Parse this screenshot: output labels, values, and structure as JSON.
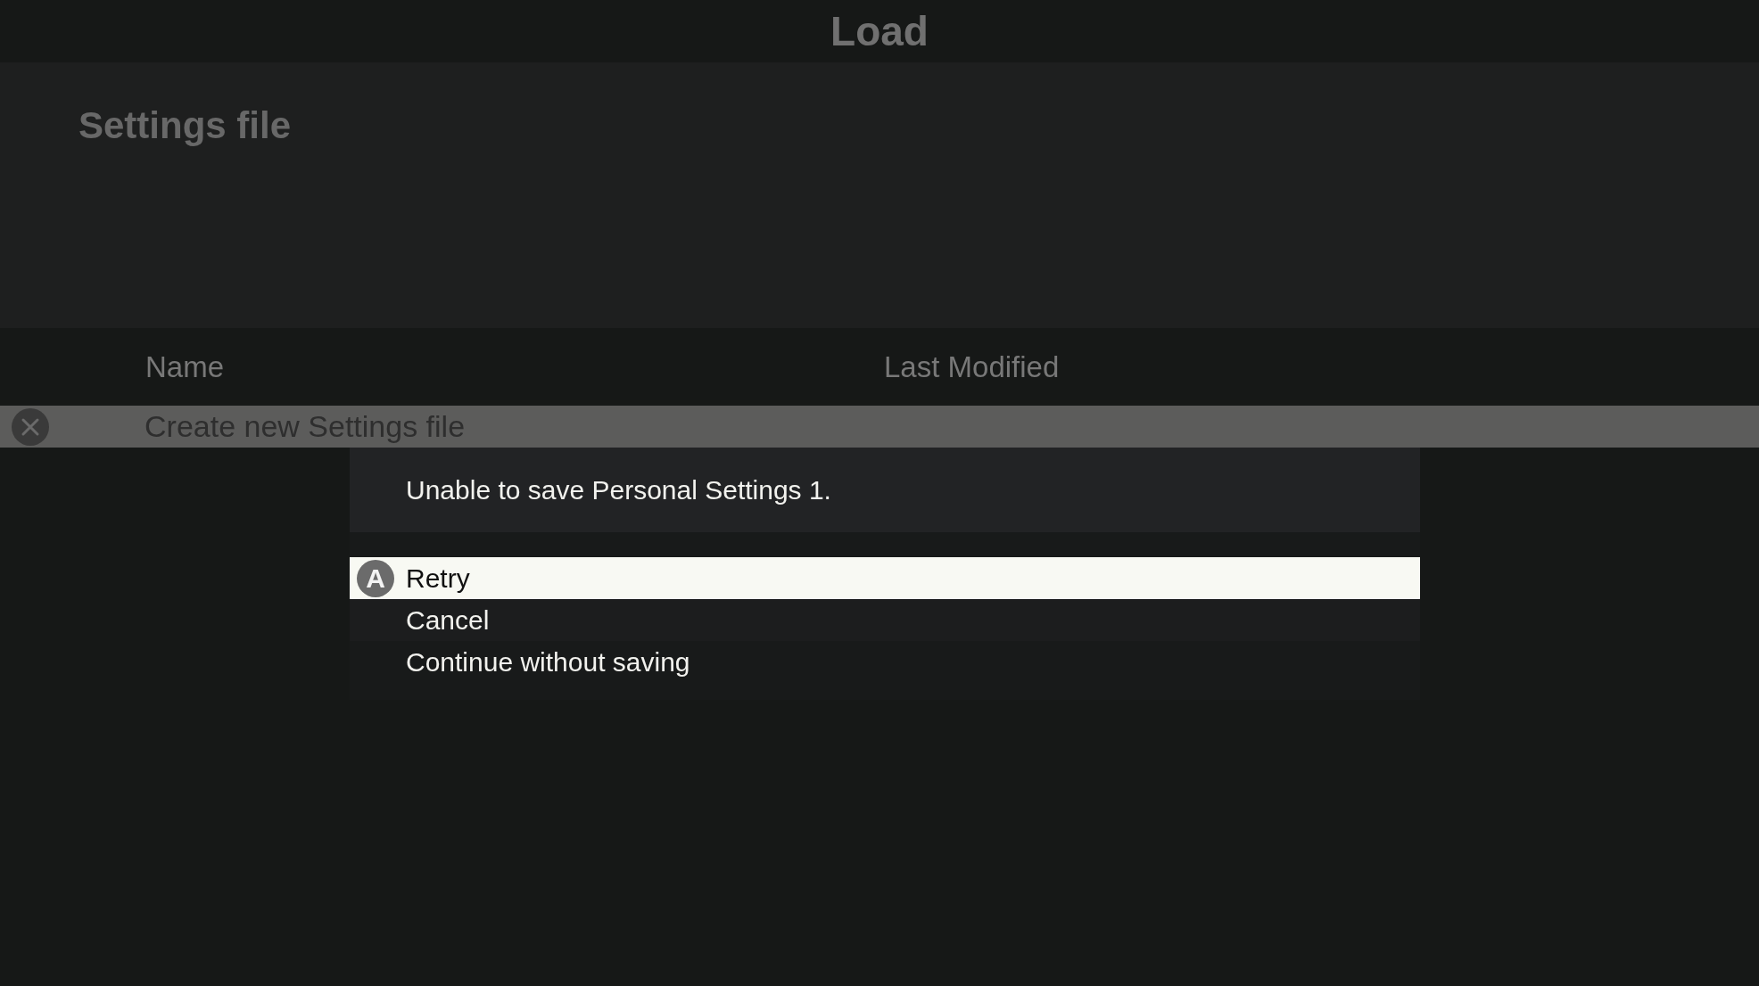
{
  "title": "Load",
  "header": {
    "title": "Settings file"
  },
  "table": {
    "columns": [
      "Name",
      "Last Modified"
    ],
    "rows": [
      {
        "name": "Create new Settings file",
        "selected": true
      }
    ]
  },
  "dialog": {
    "message": "Unable to save Personal Settings 1.",
    "options": [
      {
        "label": "Retry",
        "selected": true,
        "glyph": "A"
      },
      {
        "label": "Cancel",
        "selected": false
      },
      {
        "label": "Continue without saving",
        "selected": false
      }
    ]
  }
}
